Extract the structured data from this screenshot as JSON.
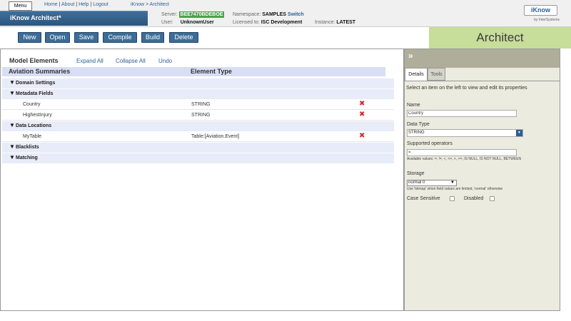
{
  "header": {
    "menu_label": "Menu",
    "links": {
      "home": "Home",
      "about": "About",
      "help": "Help",
      "logout": "Logout",
      "sep": "|"
    },
    "breadcrumb": "iKnow > Architect",
    "app_title": "iKnow Architect*",
    "server_label": "Server:",
    "server_value": "BEE7470BDEBOE",
    "user_label": "User:",
    "user_value": "UnknownUser",
    "namespace_label": "Namespace:",
    "namespace_value": "SAMPLES",
    "switch_label": "Switch",
    "licensed_label": "Licensed to:",
    "licensed_value": "ISC Development",
    "instance_label": "Instance:",
    "instance_value": "LATEST",
    "logo_text": "iKnow",
    "logo_sub": "by InterSystems"
  },
  "toolbar": {
    "buttons": [
      "New",
      "Open",
      "Save",
      "Compile",
      "Build",
      "Delete"
    ],
    "banner": "Architect"
  },
  "model": {
    "heading": "Model Elements",
    "expand_all": "Expand All",
    "collapse_all": "Collapse All",
    "undo": "Undo",
    "col_name": "Aviation Summaries",
    "col_type": "Element Type",
    "rows": [
      {
        "kind": "group",
        "name": "Domain Settings"
      },
      {
        "kind": "group",
        "name": "Metadata Fields"
      },
      {
        "kind": "item",
        "name": "Country",
        "type": "STRING"
      },
      {
        "kind": "item",
        "name": "HighestInjury",
        "type": "STRING"
      },
      {
        "kind": "group",
        "name": "Data Locations"
      },
      {
        "kind": "item",
        "name": "MyTable",
        "type": "Table:[Aviation.Event]"
      },
      {
        "kind": "group",
        "name": "Blacklists"
      },
      {
        "kind": "group",
        "name": "Matching"
      }
    ]
  },
  "details": {
    "collapse_glyph": "»",
    "tab_details": "Details",
    "tab_tools": "Tools",
    "prompt": "Select an item on the left to view and edit its properties",
    "name_label": "Name",
    "name_value": "Country",
    "datatype_label": "Data Type",
    "datatype_value": "STRING",
    "ops_label": "Supported operators",
    "ops_value": "=",
    "ops_note": "Available values: =, !=, <, <=, >, >=, IS NULL, IS NOT NULL, BETWEEN",
    "storage_label": "Storage",
    "storage_value": "normal 0",
    "storage_note": "Use 'bitmap' when field values are limited, 'normal' otherwise",
    "case_label": "Case Sensitive",
    "disabled_label": "Disabled"
  },
  "colors": {
    "toolbar_button": "#3d6c96",
    "banner": "#c7dd9a",
    "server_badge": "#49a24f",
    "delete_icon": "#d9282f"
  }
}
